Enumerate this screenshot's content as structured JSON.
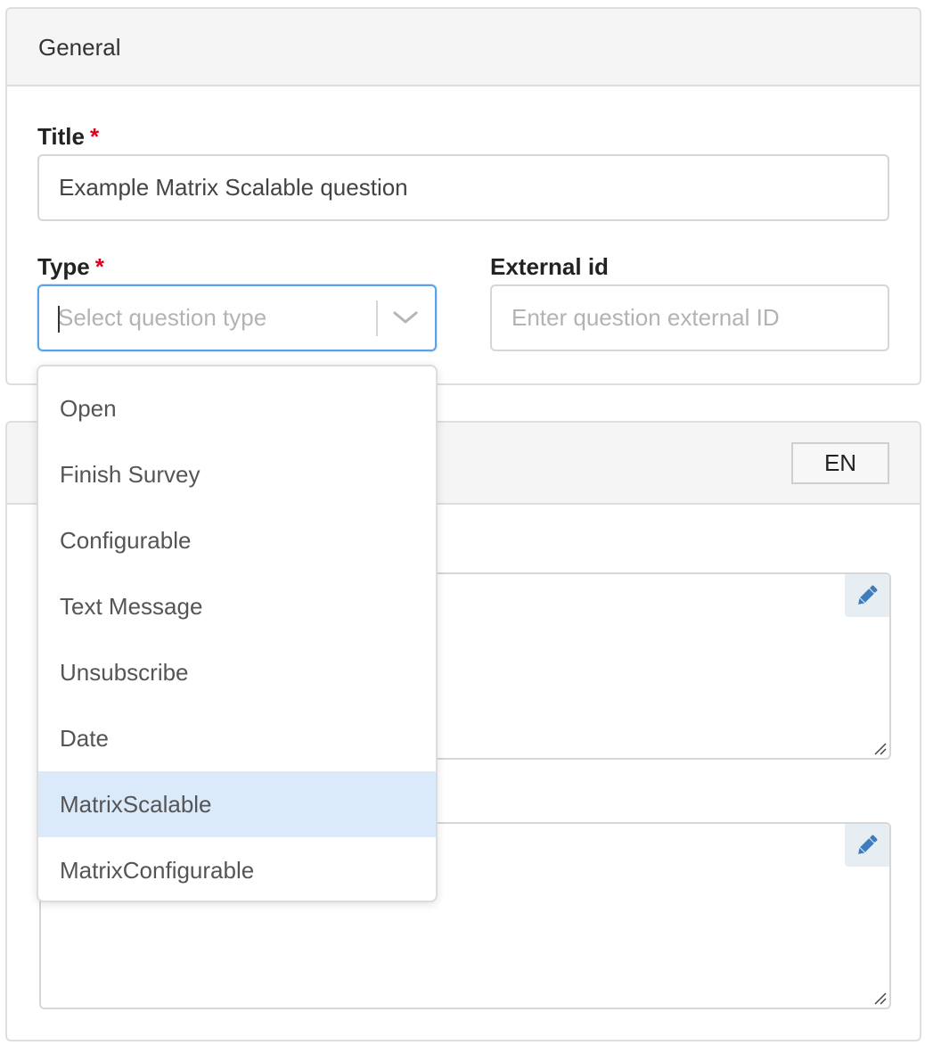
{
  "general": {
    "header": "General",
    "title_label": "Title",
    "title_required": "*",
    "title_value": "Example Matrix Scalable question",
    "type_label": "Type",
    "type_required": "*",
    "type_placeholder": "Select question type",
    "external_label": "External id",
    "external_placeholder": "Enter question external ID"
  },
  "second_panel": {
    "language": "EN"
  },
  "dropdown": {
    "options": [
      {
        "label": "Open"
      },
      {
        "label": "Finish Survey"
      },
      {
        "label": "Configurable"
      },
      {
        "label": "Text Message"
      },
      {
        "label": "Unsubscribe"
      },
      {
        "label": "Date"
      },
      {
        "label": "MatrixScalable"
      },
      {
        "label": "MatrixConfigurable"
      }
    ],
    "highlighted": "MatrixScalable"
  },
  "icons": {
    "select_arrow": "chevron-down-icon",
    "edit": "pencil-icon",
    "resize": "resize-handle-icon"
  },
  "colors": {
    "required": "#e3001b",
    "focus_border": "#5aa3e8",
    "highlight": "#dbeafb",
    "edit_icon": "#3d7dbf"
  }
}
